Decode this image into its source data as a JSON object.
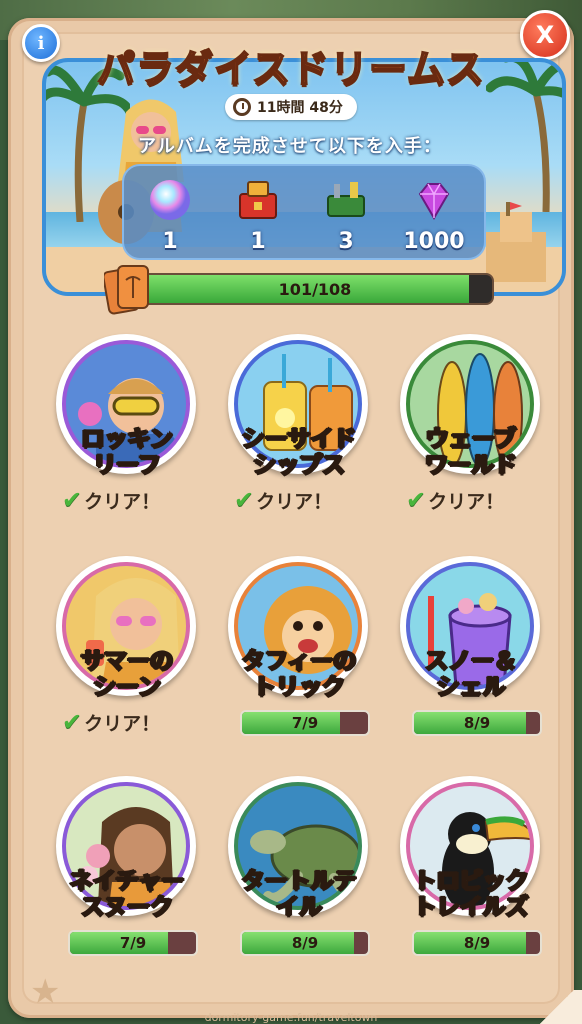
{
  "header": {
    "title": "パラダイスドリームス",
    "timer": "11時間 48分",
    "subtitle": "アルバムを完成させて以下を入手：",
    "info_label": "i",
    "close_label": "X"
  },
  "rewards": [
    {
      "icon": "rainbow-orb-icon",
      "amount": "1"
    },
    {
      "icon": "red-chest-icon",
      "amount": "1"
    },
    {
      "icon": "toolbox-icon",
      "amount": "3"
    },
    {
      "icon": "gem-icon",
      "amount": "1000"
    }
  ],
  "album_progress": {
    "text": "101/108",
    "current": 101,
    "total": 108
  },
  "sets": [
    {
      "name_line1": "ロッキン",
      "name_line2": "リーフ",
      "status": "クリア！",
      "complete": true,
      "progress": "",
      "fraction": 1.0,
      "theme": "diver"
    },
    {
      "name_line1": "シーサイド",
      "name_line2": "シップス",
      "status": "クリア！",
      "complete": true,
      "progress": "",
      "fraction": 1.0,
      "theme": "drinks"
    },
    {
      "name_line1": "ウェーブ",
      "name_line2": "ワールド",
      "status": "クリア！",
      "complete": true,
      "progress": "",
      "fraction": 1.0,
      "theme": "surfboards"
    },
    {
      "name_line1": "サマーの",
      "name_line2": "シーン",
      "status": "クリア！",
      "complete": true,
      "progress": "",
      "fraction": 1.0,
      "theme": "summer-girl"
    },
    {
      "name_line1": "タフィーの",
      "name_line2": "トリック",
      "status": "",
      "complete": false,
      "progress": "7/9",
      "fraction": 0.778,
      "theme": "monkey"
    },
    {
      "name_line1": "スノー＆",
      "name_line2": "シェル",
      "status": "",
      "complete": false,
      "progress": "8/9",
      "fraction": 0.889,
      "theme": "bucket"
    },
    {
      "name_line1": "ネイチャー",
      "name_line2": "スヌーク",
      "status": "",
      "complete": false,
      "progress": "7/9",
      "fraction": 0.778,
      "theme": "nature-girl"
    },
    {
      "name_line1": "タートルテ",
      "name_line2": "イル",
      "status": "",
      "complete": false,
      "progress": "8/9",
      "fraction": 0.889,
      "theme": "turtle"
    },
    {
      "name_line1": "トロピック",
      "name_line2": "トレイルズ",
      "status": "",
      "complete": false,
      "progress": "8/9",
      "fraction": 0.889,
      "theme": "toucan"
    }
  ],
  "watermark": "dormitory-game.fun/traveltown",
  "colors": {
    "accent_green": "#3da83d",
    "title_orange": "#ff8a3a",
    "frame_blue": "#3a8fd8"
  }
}
